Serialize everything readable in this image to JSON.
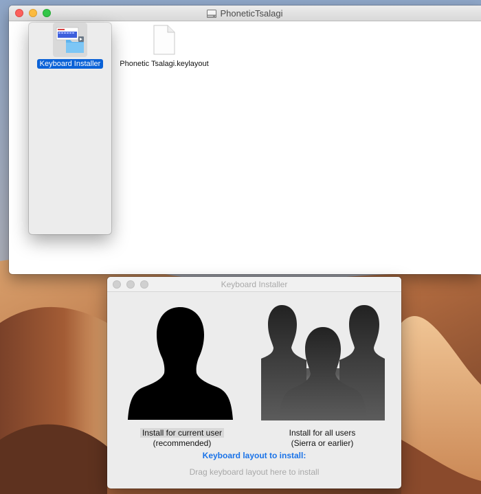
{
  "desktop": {
    "wallpaper": "Mojave desert dunes"
  },
  "finder": {
    "title": "PhoneticTsalagi",
    "files": [
      {
        "label": "Keyboard Installer",
        "selected": true,
        "icon": "keyboard-installer-app-icon"
      },
      {
        "label": "Phonetic Tsalagi.keylayout",
        "selected": false,
        "icon": "document-icon"
      }
    ]
  },
  "installer": {
    "title": "Keyboard Installer",
    "option_current_line1": "Install for current user",
    "option_current_line2": "(recommended)",
    "option_all_line1": "Install for all users",
    "option_all_line2": "(Sierra or earlier)",
    "layout_heading": "Keyboard layout to install:",
    "drop_hint": "Drag keyboard layout here to install"
  },
  "colors": {
    "selection": "#0b62d7",
    "accent_link": "#1a73e8",
    "close": "#fc605c",
    "minimize": "#fdbc40",
    "maximize": "#34c84a"
  }
}
